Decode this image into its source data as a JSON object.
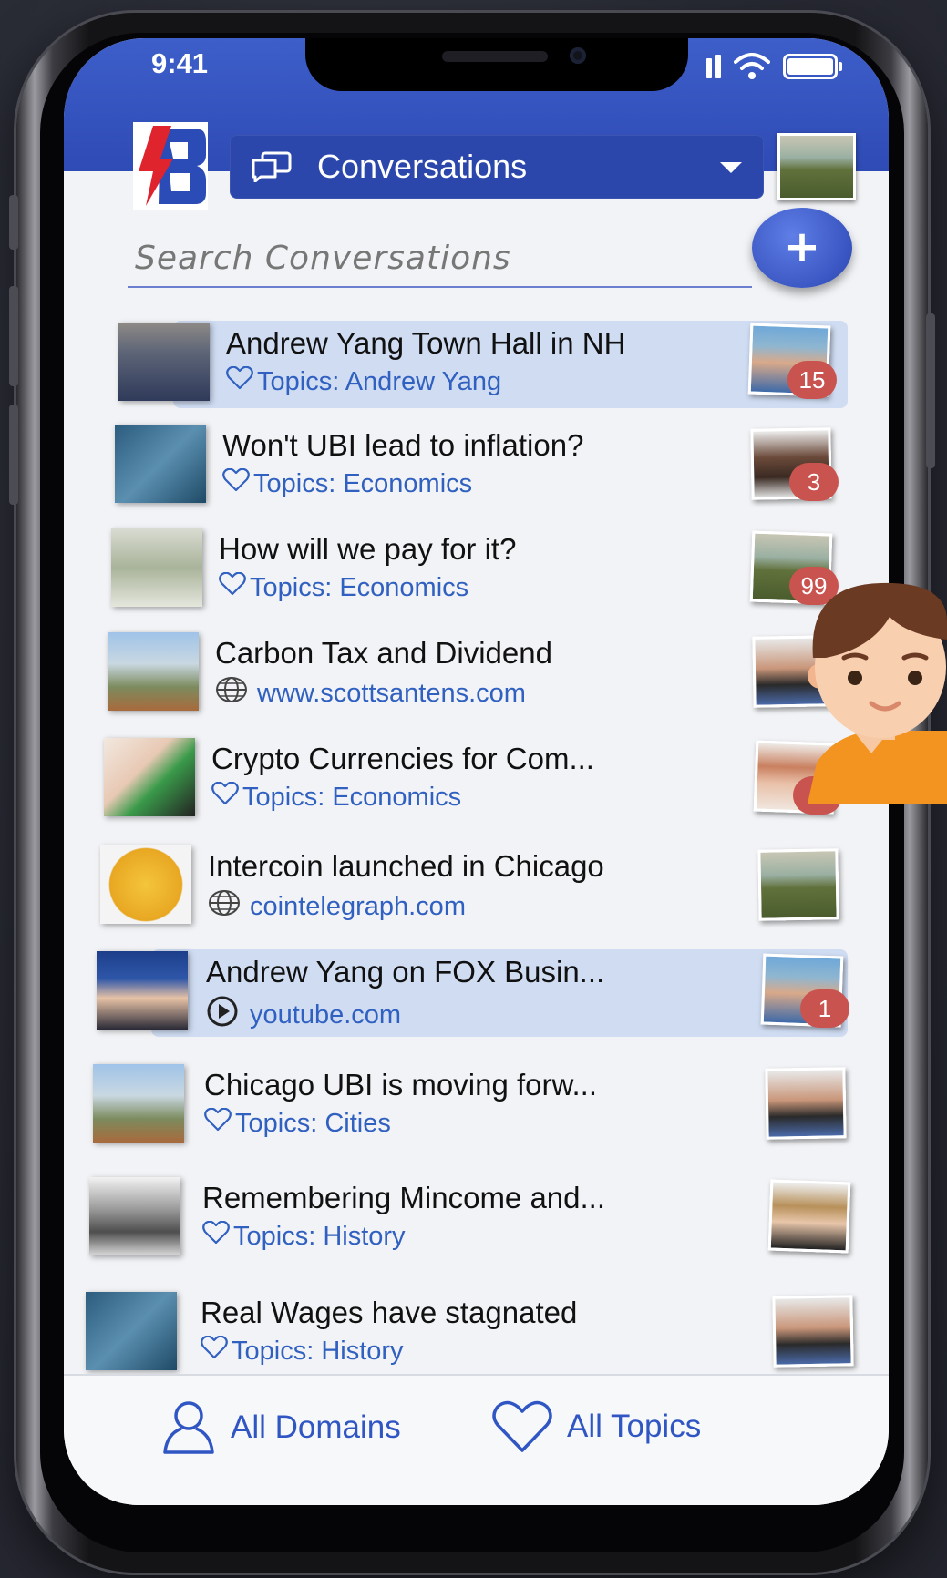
{
  "status_bar": {
    "time": "9:41"
  },
  "header": {
    "title": "Conversations",
    "logo_letter": "B"
  },
  "search": {
    "placeholder": "Search Conversations",
    "add_label": "+"
  },
  "conversations": [
    {
      "title": "Andrew Yang Town Hall in NH",
      "subtitle": "Topics: Andrew Yang",
      "subtitle_icon": "heart-outline-icon",
      "badge": "15",
      "highlight": true
    },
    {
      "title": "Won't UBI lead to inflation?",
      "subtitle": "Topics: Economics",
      "subtitle_icon": "heart-outline-icon",
      "badge": "3",
      "highlight": false
    },
    {
      "title": "How will we pay for it?",
      "subtitle": "Topics: Economics",
      "subtitle_icon": "heart-outline-icon",
      "badge": "99",
      "highlight": false
    },
    {
      "title": "Carbon Tax and Dividend",
      "subtitle": "www.scottsantens.com",
      "subtitle_icon": "globe-icon",
      "badge": "",
      "highlight": false
    },
    {
      "title": "Crypto Currencies for Com...",
      "subtitle": "Topics: Economics",
      "subtitle_icon": "heart-outline-icon",
      "badge": "3",
      "highlight": false
    },
    {
      "title": "Intercoin launched in Chicago",
      "subtitle": "cointelegraph.com",
      "subtitle_icon": "globe-icon",
      "badge": "",
      "highlight": false
    },
    {
      "title": "Andrew Yang on FOX Busin...",
      "subtitle": "youtube.com",
      "subtitle_icon": "play-icon",
      "badge": "1",
      "highlight": true
    },
    {
      "title": "Chicago UBI is moving forw...",
      "subtitle": "Topics: Cities",
      "subtitle_icon": "heart-outline-icon",
      "badge": "",
      "highlight": false
    },
    {
      "title": "Remembering Mincome and...",
      "subtitle": "Topics: History",
      "subtitle_icon": "heart-outline-icon",
      "badge": "",
      "highlight": false
    },
    {
      "title": "Real Wages have stagnated",
      "subtitle": "Topics: History",
      "subtitle_icon": "heart-outline-icon",
      "badge": "",
      "highlight": false
    }
  ],
  "tabbar": {
    "domains_label": "All Domains",
    "topics_label": "All Topics"
  },
  "colors": {
    "header": "#2f4bb5",
    "accent": "#3060c0",
    "badge": "#c9544f",
    "highlight_row": "#cfdcf2"
  }
}
